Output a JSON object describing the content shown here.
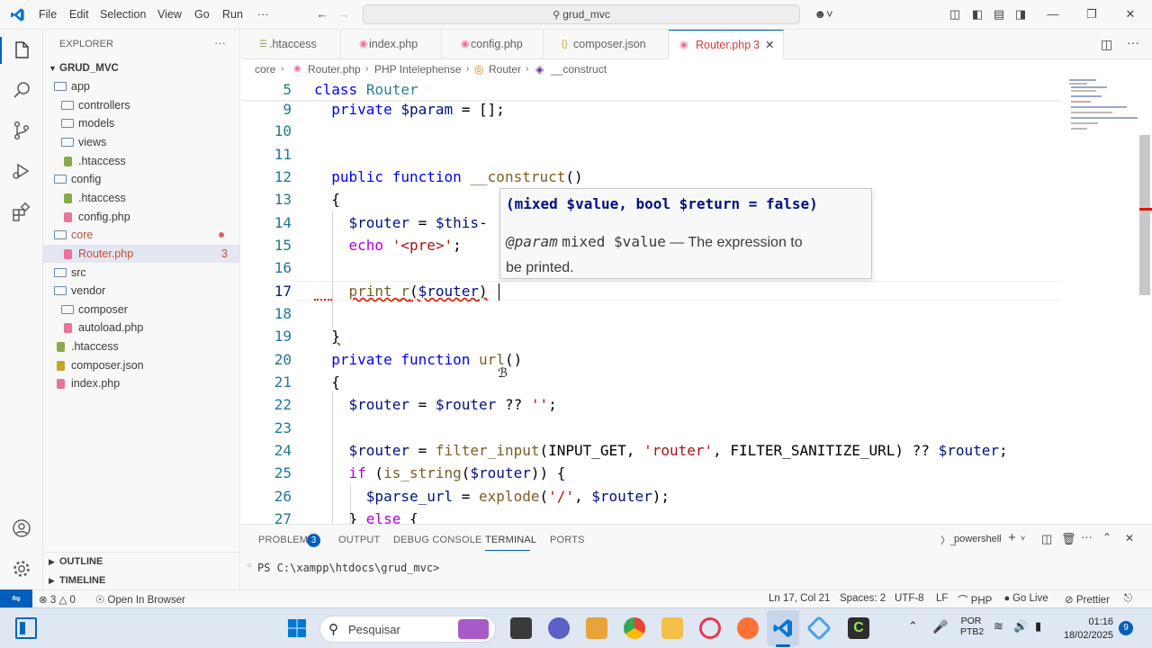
{
  "titlebar": {
    "menu": [
      "File",
      "Edit",
      "Selection",
      "View",
      "Go",
      "Run",
      "···"
    ],
    "search": "grud_mvc"
  },
  "sidebar": {
    "header": "EXPLORER",
    "project": "GRUD_MVC",
    "items": [
      {
        "label": "app",
        "type": "folder",
        "depth": 0
      },
      {
        "label": "controllers",
        "type": "folder",
        "depth": 1
      },
      {
        "label": "models",
        "type": "folder",
        "depth": 1
      },
      {
        "label": "views",
        "type": "folder",
        "depth": 1
      },
      {
        "label": ".htaccess",
        "type": "htaccess",
        "depth": 1
      },
      {
        "label": "config",
        "type": "folder",
        "depth": 0
      },
      {
        "label": ".htaccess",
        "type": "htaccess",
        "depth": 1
      },
      {
        "label": "config.php",
        "type": "php",
        "depth": 1
      },
      {
        "label": "core",
        "type": "folder",
        "depth": 0
      },
      {
        "label": "Router.php",
        "type": "php",
        "depth": 1
      },
      {
        "label": "src",
        "type": "folder",
        "depth": 0
      },
      {
        "label": "vendor",
        "type": "folder",
        "depth": 0
      },
      {
        "label": "composer",
        "type": "folder",
        "depth": 1
      },
      {
        "label": "autoload.php",
        "type": "php",
        "depth": 1
      },
      {
        "label": ".htaccess",
        "type": "htaccess",
        "depth": 0
      },
      {
        "label": "composer.json",
        "type": "json",
        "depth": 0
      },
      {
        "label": "index.php",
        "type": "php",
        "depth": 0
      }
    ],
    "router_count": "3",
    "outline": "OUTLINE",
    "timeline": "TIMELINE"
  },
  "tabs": [
    {
      "label": ".htaccess",
      "active": false
    },
    {
      "label": "index.php",
      "active": false
    },
    {
      "label": "config.php",
      "active": false
    },
    {
      "label": "composer.json",
      "active": false
    },
    {
      "label": "Router.php",
      "active": true,
      "count": "3"
    }
  ],
  "breadcrumb": [
    "core",
    "Router.php",
    "PHP Intelephense",
    "Router",
    "__construct"
  ],
  "editor": {
    "line_numbers": [
      "5",
      "9",
      "10",
      "11",
      "12",
      "13",
      "14",
      "15",
      "16",
      "17",
      "18",
      "19",
      "20",
      "21",
      "22",
      "23",
      "24",
      "25",
      "26",
      "27"
    ],
    "current_line": "17"
  },
  "hover": {
    "signature_params": "(mixed $value, bool $return = false)",
    "param_tag": "@param",
    "param_decl": "mixed $value",
    "param_desc_1": "— The expression to",
    "param_desc_2": "be printed."
  },
  "panel": {
    "tabs": [
      "PROBLEMS",
      "OUTPUT",
      "DEBUG CONSOLE",
      "TERMINAL",
      "PORTS"
    ],
    "problems_count": "3",
    "active_tab": "TERMINAL",
    "shell": "powershell",
    "prompt": "PS C:\\xampp\\htdocs\\grud_mvc>"
  },
  "statusbar": {
    "errors": "3",
    "warnings": "0",
    "open_browser": "Open In Browser",
    "position": "Ln 17, Col 21",
    "spaces": "Spaces: 2",
    "encoding": "UTF-8",
    "eol": "LF",
    "language": "PHP",
    "golive": "Go Live",
    "prettier": "Prettier"
  },
  "taskbar": {
    "search": "Pesquisar",
    "lang_1": "POR",
    "lang_2": "PTB2",
    "time": "01:16",
    "date": "18/02/2025",
    "notif": "9"
  },
  "colors": {
    "accent": "#005fb8",
    "keyword": "#0000ff",
    "variable": "#001080",
    "string": "#a31515",
    "function": "#795e26",
    "class": "#267f99",
    "line_number": "#237893"
  }
}
